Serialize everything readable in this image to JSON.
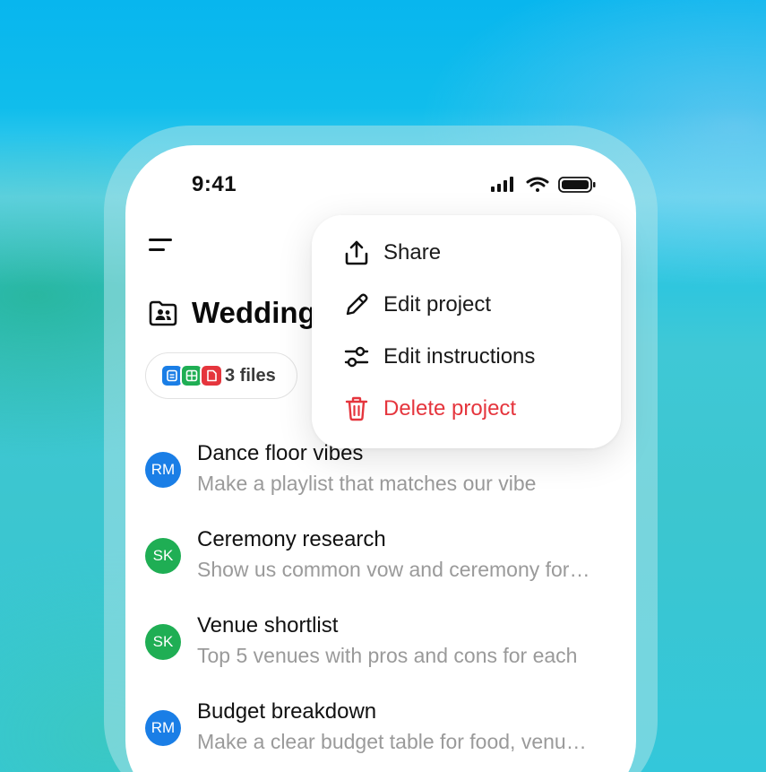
{
  "status_bar": {
    "time": "9:41"
  },
  "project": {
    "title": "Wedding",
    "files_label": "3 files",
    "file_icons": [
      {
        "icon": "document-icon",
        "color": "#1a7ee6"
      },
      {
        "icon": "spreadsheet-icon",
        "color": "#1fae54"
      },
      {
        "icon": "pdf-icon",
        "color": "#e5353d"
      }
    ]
  },
  "chats": [
    {
      "initials": "RM",
      "avatar_color": "#1a7ee6",
      "title": "Dance floor vibes",
      "subtitle": "Make a playlist that matches our vibe"
    },
    {
      "initials": "SK",
      "avatar_color": "#1fae54",
      "title": "Ceremony research",
      "subtitle": "Show us common vow and ceremony for…"
    },
    {
      "initials": "SK",
      "avatar_color": "#1fae54",
      "title": "Venue shortlist",
      "subtitle": "Top 5 venues with pros and cons for each"
    },
    {
      "initials": "RM",
      "avatar_color": "#1a7ee6",
      "title": "Budget breakdown",
      "subtitle": "Make a clear budget table for food, venu…"
    }
  ],
  "menu": {
    "items": [
      {
        "label": "Share",
        "icon": "share-icon"
      },
      {
        "label": "Edit project",
        "icon": "pencil-icon"
      },
      {
        "label": "Edit instructions",
        "icon": "sliders-icon"
      },
      {
        "label": "Delete project",
        "icon": "trash-icon",
        "color": "#e5353d"
      }
    ]
  }
}
